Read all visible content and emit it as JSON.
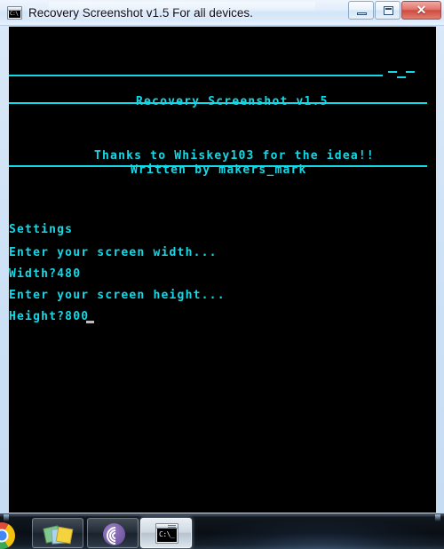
{
  "window": {
    "title": "Recovery Screenshot v1.5 For all devices.",
    "icon": "console-icon",
    "controls": {
      "minimize_label": "",
      "restore_label": "",
      "close_label": "✕"
    }
  },
  "console": {
    "foreground_color": "#12d9e8",
    "background_color": "#000000",
    "cursor_color": "#bdbdbd",
    "banner": {
      "title": "Recovery Screenshot v1.5",
      "thanks": "Thanks to Whiskey103 for the idea!!",
      "author": "Written by makers_mark"
    },
    "settings": {
      "heading": "Settings",
      "width_prompt": "Enter your screen width...",
      "width_answer": "Width?480",
      "width_value": "480",
      "height_prompt": "Enter your screen height...",
      "height_answer": "Height?800",
      "height_value": "800"
    }
  },
  "taskbar": {
    "items": [
      {
        "name": "chrome",
        "label": "Google Chrome",
        "active": false
      },
      {
        "name": "sticky-notes",
        "label": "Sticky Notes",
        "active": false
      },
      {
        "name": "bittorrent",
        "label": "BitTorrent",
        "active": false
      },
      {
        "name": "command-prompt",
        "label": "Recovery Screenshot v1.5 For all devices.",
        "active": true
      }
    ],
    "cmd_icon_text": "C:\\_"
  }
}
